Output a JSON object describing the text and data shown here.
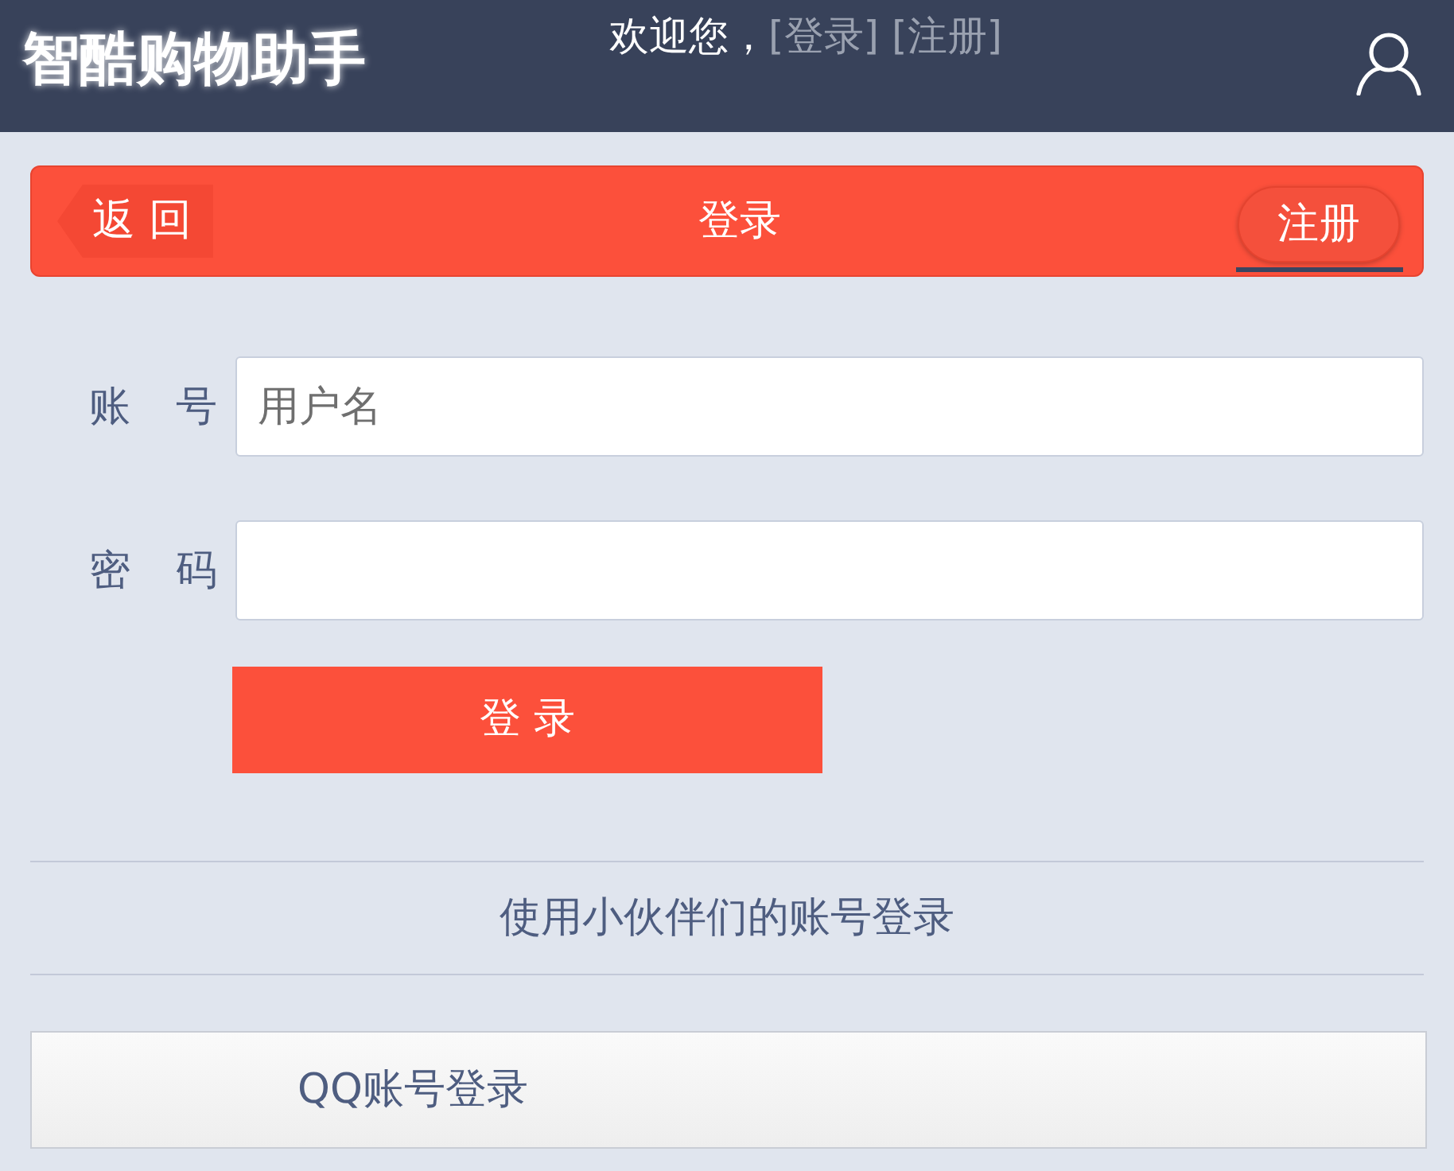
{
  "header": {
    "title": "智酷购物助手",
    "welcome": "欢迎您，",
    "links": [
      "[登录]",
      "[注册]"
    ]
  },
  "nav_bar": {
    "back_button": "返 回",
    "title": "登录",
    "register_button": "注册"
  },
  "form": {
    "fields": [
      {
        "label": "账 号",
        "placeholder": "用户名"
      },
      {
        "label": "密 码"
      }
    ],
    "submit": "登 录"
  },
  "partner_login": {
    "heading": "使用小伙伴们的账号登录",
    "buttons": [
      "QQ账号登录"
    ]
  }
}
